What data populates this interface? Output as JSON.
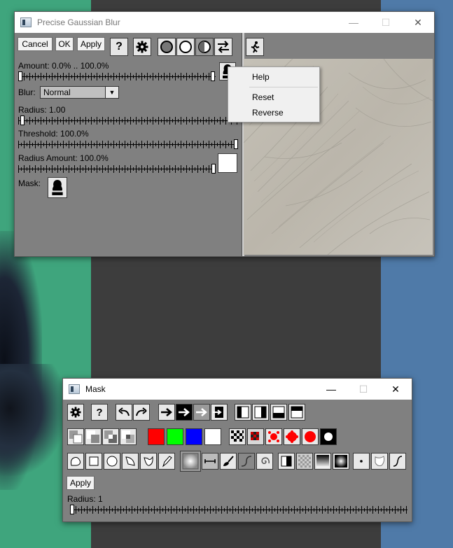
{
  "blur_window": {
    "title": "Precise Gaussian Blur",
    "cancel_label": "Cancel",
    "ok_label": "OK",
    "apply_label": "Apply",
    "help_label": "?",
    "amount_label": "Amount: 0.0% .. 100.0%",
    "blur_label": "Blur:",
    "blur_mode": "Normal",
    "radius_label": "Radius: 1.00",
    "threshold_label": "Threshold: 100.0%",
    "radius_amount_label": "Radius Amount: 100.0%",
    "mask_label": "Mask:"
  },
  "context_menu": {
    "items": [
      "Help",
      "Reset",
      "Reverse"
    ]
  },
  "mask_window": {
    "title": "Mask",
    "help_label": "?",
    "apply_label": "Apply",
    "radius_label": "Radius: 1",
    "colors": {
      "red": "#ff0000",
      "green": "#00ff00",
      "blue": "#0000ff",
      "white": "#ffffff"
    }
  },
  "window_controls": {
    "minimize": "—",
    "maximize": "☐",
    "close": "✕"
  }
}
